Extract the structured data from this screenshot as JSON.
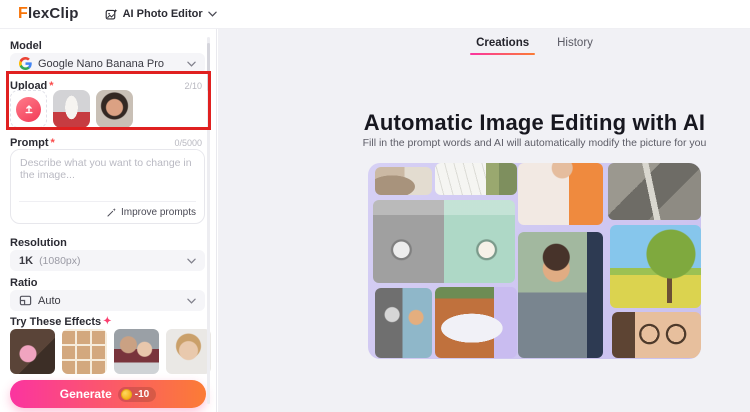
{
  "header": {
    "logo_f": "F",
    "logo_rest": "lexClip",
    "app_menu": "AI Photo Editor"
  },
  "sidebar": {
    "model": {
      "label": "Model",
      "value": "Google Nano Banana Pro"
    },
    "upload": {
      "label": "Upload",
      "required_mark": "*",
      "count": "2/10"
    },
    "prompt": {
      "label": "Prompt",
      "required_mark": "*",
      "count": "0/5000",
      "placeholder": "Describe what you want to change in the image...",
      "improve_label": "Improve prompts"
    },
    "resolution": {
      "label": "Resolution",
      "value": "1K",
      "value_detail": "(1080px)"
    },
    "ratio": {
      "label": "Ratio",
      "value": "Auto"
    },
    "effects": {
      "label": "Try These Effects",
      "sparkle_glyph": "✦"
    },
    "generate": {
      "label": "Generate",
      "cost": "-10"
    }
  },
  "main": {
    "tabs": [
      {
        "label": "Creations",
        "active": true
      },
      {
        "label": "History",
        "active": false
      }
    ],
    "heading": "Automatic Image Editing with AI",
    "subheading": "Fill in the prompt words and AI will automatically modify the picture for you"
  },
  "colors": {
    "accent_gradient_start": "#fb34a0",
    "accent_gradient_end": "#fb7c35",
    "annotation_red": "#e02020",
    "main_background": "#f1f1f5",
    "brand_orange": "#f77408"
  },
  "icons": {
    "app_menu_icon": "photo-editor-icon",
    "model_icon": "google-g-icon",
    "upload_icon": "upload-arrow-icon",
    "improve_icon": "wand-sparkle-icon",
    "ratio_icon": "aspect-ratio-icon",
    "coin_icon": "coin-icon",
    "chevron_icon": "chevron-down-icon"
  }
}
